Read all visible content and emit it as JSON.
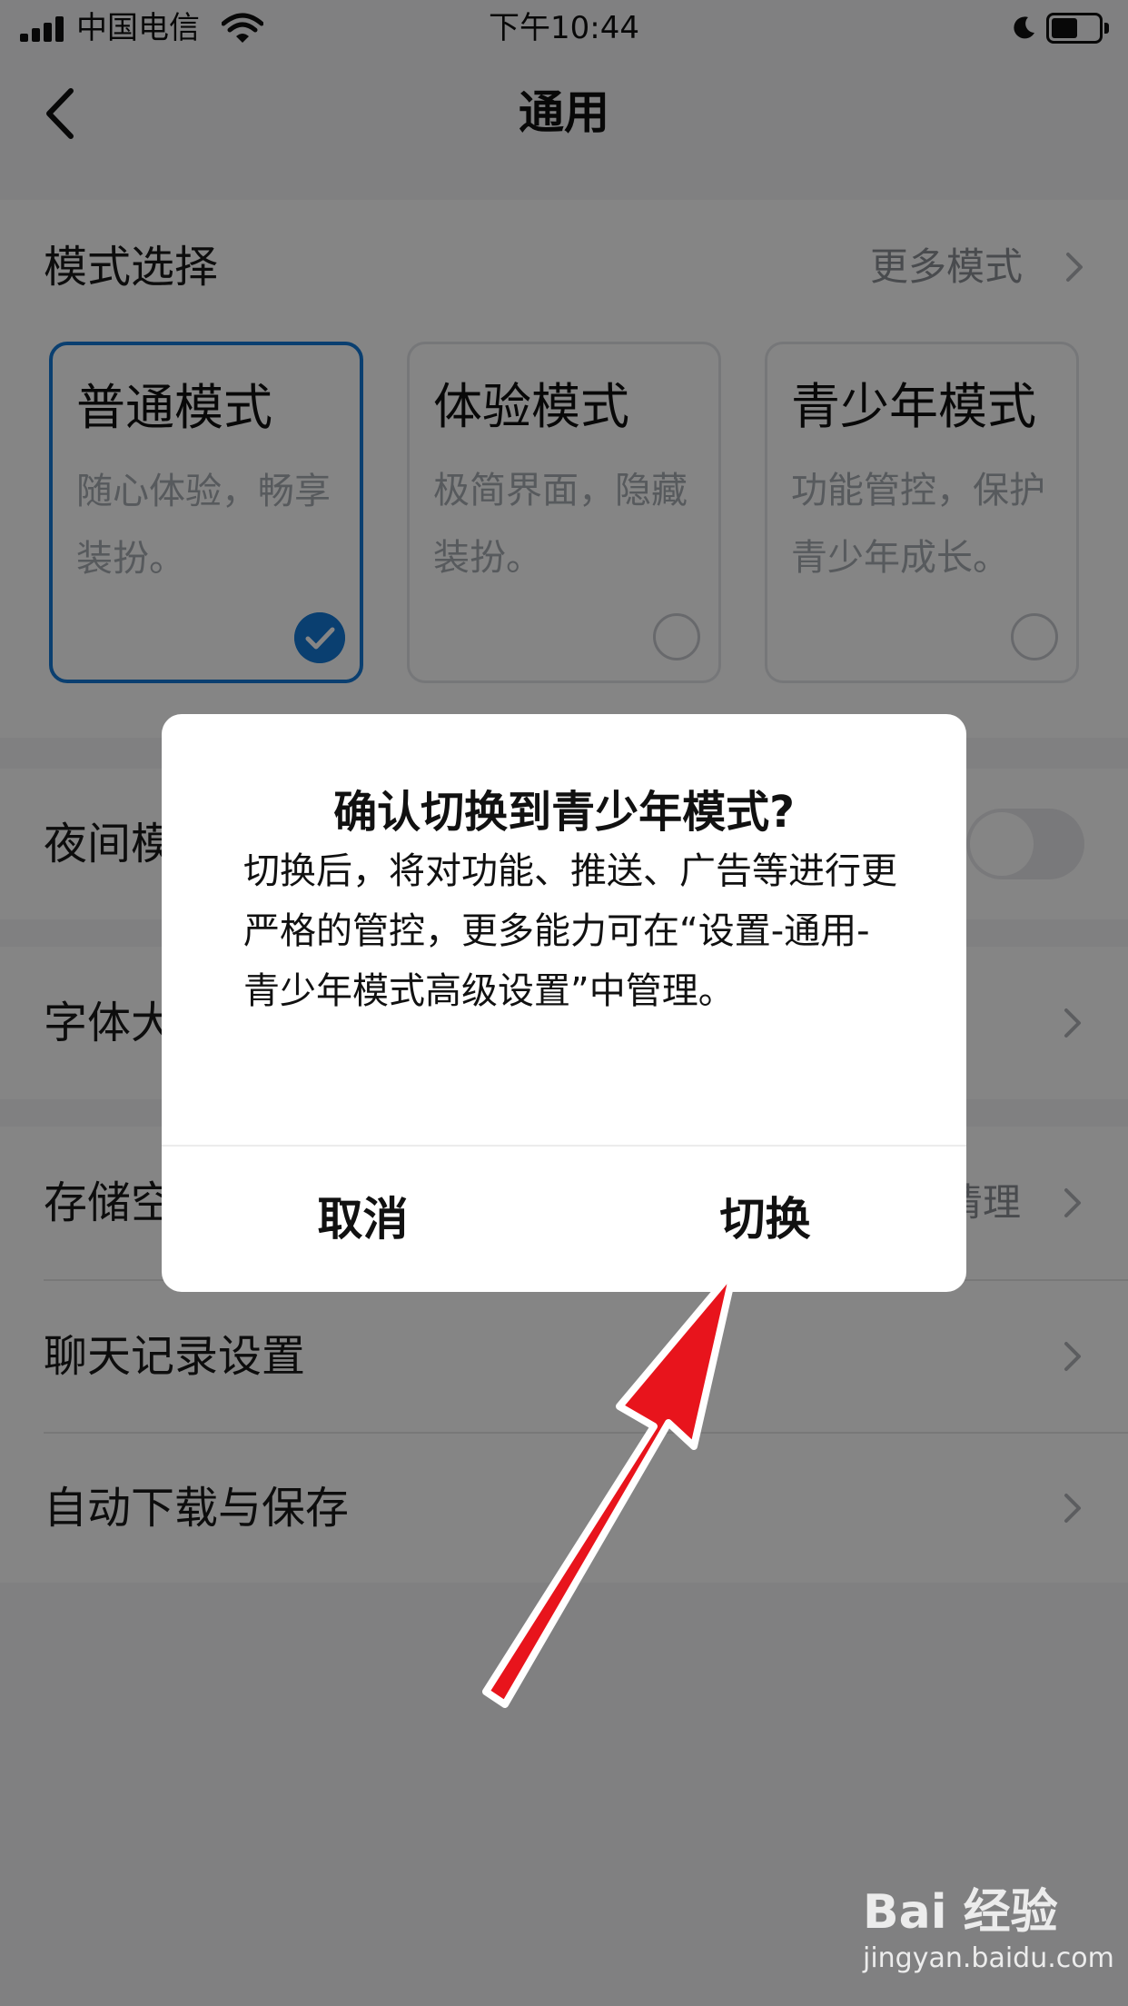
{
  "status_bar": {
    "carrier": "中国电信",
    "time": "下午10:44",
    "icons": [
      "signal-icon",
      "wifi-icon",
      "moon-icon",
      "battery-icon"
    ]
  },
  "nav": {
    "title": "通用",
    "back_icon": "chevron-left-icon"
  },
  "mode_section": {
    "label": "模式选择",
    "more_label": "更多模式",
    "cards": [
      {
        "title": "普通模式",
        "desc": "随心体验，畅享装扮。",
        "selected": true
      },
      {
        "title": "体验模式",
        "desc": "极简界面，隐藏装扮。",
        "selected": false
      },
      {
        "title": "青少年模式",
        "desc": "功能管控，保护青少年成长。",
        "selected": false
      }
    ]
  },
  "rows": {
    "night_mode": "夜间模",
    "font_size": "字体大",
    "storage": "存储空",
    "storage_value": "清理",
    "chat_history": "聊天记录设置",
    "auto_download": "自动下载与保存"
  },
  "dialog": {
    "title": "确认切换到青少年模式?",
    "message": "切换后，将对功能、推送、广告等进行更严格的管控，更多能力可在“设置-通用-青少年模式高级设置”中管理。",
    "cancel_label": "取消",
    "confirm_label": "切换"
  },
  "watermark": {
    "logo": "Bai 经验",
    "url": "jingyan.baidu.com"
  },
  "colors": {
    "accent": "#1479d7",
    "annotation_arrow": "#e8141c",
    "overlay": "rgba(0,0,0,0.48)"
  }
}
